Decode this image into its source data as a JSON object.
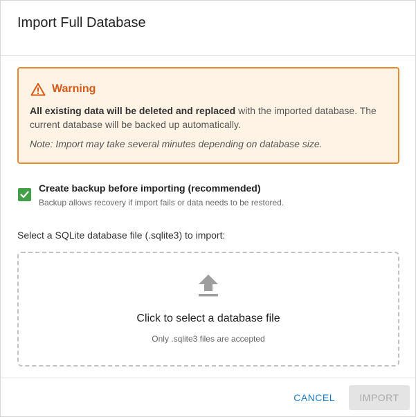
{
  "dialog": {
    "title": "Import Full Database"
  },
  "warning": {
    "icon": "warning-triangle-icon",
    "title": "Warning",
    "text_bold": "All existing data will be deleted and replaced",
    "text_rest": " with the imported database. The current database will be backed up automatically.",
    "note": "Note: Import may take several minutes depending on database size.",
    "colors": {
      "border": "#e8892f",
      "background": "#fff3e5",
      "title": "#d65a16"
    }
  },
  "backup": {
    "checked": true,
    "label": "Create backup before importing (recommended)",
    "help": "Backup allows recovery if import fails or data needs to be restored.",
    "checkbox_color": "#43a047"
  },
  "file_select": {
    "label": "Select a SQLite database file (.sqlite3) to import:",
    "dropzone_icon": "upload-icon",
    "dropzone_title": "Click to select a database file",
    "dropzone_subtitle": "Only .sqlite3 files are accepted"
  },
  "footer": {
    "cancel_label": "CANCEL",
    "import_label": "IMPORT",
    "import_disabled": true,
    "accent_color": "#1f7ac8"
  }
}
